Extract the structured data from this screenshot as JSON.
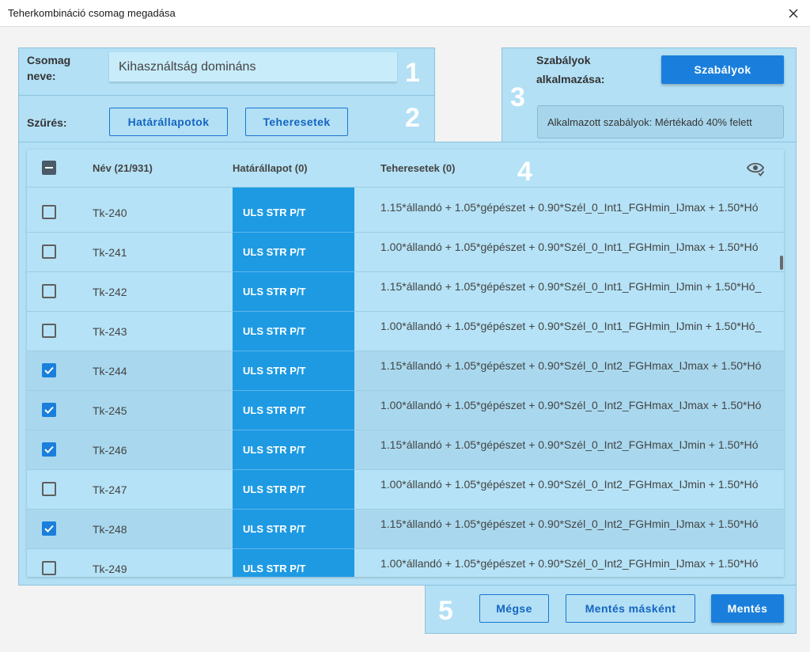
{
  "window": {
    "title": "Teherkombináció csomag megadása",
    "close_icon": "close-icon"
  },
  "section_numbers": [
    "1",
    "2",
    "3",
    "4",
    "5"
  ],
  "package": {
    "label_line1": "Csomag",
    "label_line2": "neve:",
    "value": "Kihasználtság domináns"
  },
  "filter": {
    "label": "Szűrés:",
    "limit_states_button": "Határállapotok",
    "load_cases_button": "Teheresetek"
  },
  "rules": {
    "label_line1": "Szabályok",
    "label_line2": "alkalmazása:",
    "button": "Szabályok",
    "applied_text": "Alkalmazott szabályok: Mértékadó 40% felett"
  },
  "table": {
    "select_all_state": "indeterminate",
    "columns": {
      "name": "Név (21/931)",
      "limit_state": "Határállapot (0)",
      "load_cases": "Teheresetek (0)"
    },
    "column_visibility_icon": "eye-check-icon",
    "rows": [
      {
        "name": "Tk-240",
        "checked": false,
        "limit_state": "ULS STR P/T",
        "formula": "1.15*állandó + 1.05*gépészet + 0.90*Szél_0_Int1_FGHmin_IJmax + 1.50*Hó"
      },
      {
        "name": "Tk-241",
        "checked": false,
        "limit_state": "ULS STR P/T",
        "formula": "1.00*állandó + 1.05*gépészet + 0.90*Szél_0_Int1_FGHmin_IJmax + 1.50*Hó"
      },
      {
        "name": "Tk-242",
        "checked": false,
        "limit_state": "ULS STR P/T",
        "formula": "1.15*állandó + 1.05*gépészet + 0.90*Szél_0_Int1_FGHmin_IJmin + 1.50*Hó_"
      },
      {
        "name": "Tk-243",
        "checked": false,
        "limit_state": "ULS STR P/T",
        "formula": "1.00*állandó + 1.05*gépészet + 0.90*Szél_0_Int1_FGHmin_IJmin + 1.50*Hó_"
      },
      {
        "name": "Tk-244",
        "checked": true,
        "limit_state": "ULS STR P/T",
        "formula": "1.15*állandó + 1.05*gépészet + 0.90*Szél_0_Int2_FGHmax_IJmax + 1.50*Hó"
      },
      {
        "name": "Tk-245",
        "checked": true,
        "limit_state": "ULS STR P/T",
        "formula": "1.00*állandó + 1.05*gépészet + 0.90*Szél_0_Int2_FGHmax_IJmax + 1.50*Hó"
      },
      {
        "name": "Tk-246",
        "checked": true,
        "limit_state": "ULS STR P/T",
        "formula": "1.15*állandó + 1.05*gépészet + 0.90*Szél_0_Int2_FGHmax_IJmin + 1.50*Hó"
      },
      {
        "name": "Tk-247",
        "checked": false,
        "limit_state": "ULS STR P/T",
        "formula": "1.00*állandó + 1.05*gépészet + 0.90*Szél_0_Int2_FGHmax_IJmin + 1.50*Hó"
      },
      {
        "name": "Tk-248",
        "checked": true,
        "limit_state": "ULS STR P/T",
        "formula": "1.15*állandó + 1.05*gépészet + 0.90*Szél_0_Int2_FGHmin_IJmax + 1.50*Hó"
      },
      {
        "name": "Tk-249",
        "checked": false,
        "limit_state": "ULS STR P/T",
        "formula": "1.00*állandó + 1.05*gépészet + 0.90*Szél_0_Int2_FGHmin_IJmax + 1.50*Hó"
      }
    ]
  },
  "footer": {
    "cancel_button": "Mégse",
    "save_as_button": "Mentés másként",
    "save_button": "Mentés"
  },
  "colors": {
    "panel_bg": "#b3e0f5",
    "accent": "#1a7fdc",
    "limit_state_cell": "#1e9ae3",
    "section_number": "#ffffff"
  }
}
